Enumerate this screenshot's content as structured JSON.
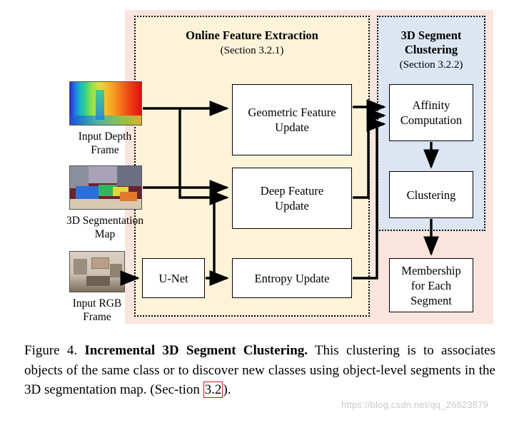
{
  "panels": {
    "online_feature_extraction": {
      "title": "Online Feature Extraction",
      "subtitle": "(Section 3.2.1)"
    },
    "segment_clustering": {
      "title": "3D Segment\nClustering",
      "subtitle": "(Section 3.2.2)"
    }
  },
  "boxes": {
    "geometric_feature_update": "Geometric Feature\nUpdate",
    "deep_feature_update": "Deep Feature\nUpdate",
    "entropy_update": "Entropy Update",
    "unet": "U-Net",
    "affinity_computation": "Affinity\nComputation",
    "clustering": "Clustering",
    "membership": "Membership\nfor Each\nSegment"
  },
  "inputs": [
    {
      "name": "input-depth-frame",
      "caption": "Input Depth\nFrame"
    },
    {
      "name": "3d-segmentation-map",
      "caption": "3D Segmentation\nMap"
    },
    {
      "name": "input-rgb-frame",
      "caption": "Input RGB\nFrame"
    }
  ],
  "caption": {
    "label": "Figure 4.",
    "title": "Incremental 3D Segment Clustering.",
    "body_1": " This clustering is to associates objects of the same class or to discover new classes using object-level segments in the 3D segmentation map.  (Sec-tion ",
    "ref": "3.2",
    "body_2": ")."
  },
  "watermark": "https://blog.csdn.net/qq_26623879",
  "colors": {
    "pink_panel": "#fbe4de",
    "yellow_panel": "#fdf3d8",
    "blue_panel": "#dce6f2",
    "ref_box_border": "#d01c1c"
  }
}
